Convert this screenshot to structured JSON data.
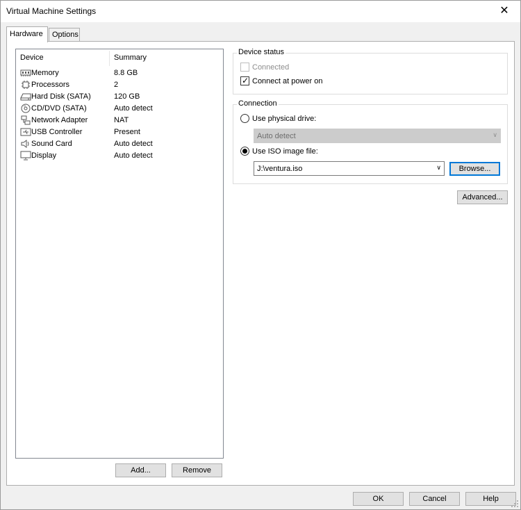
{
  "window": {
    "title": "Virtual Machine Settings",
    "close_glyph": "✕"
  },
  "tabs": [
    {
      "label": "Hardware",
      "active": true
    },
    {
      "label": "Options",
      "active": false
    }
  ],
  "device_list": {
    "columns": [
      "Device",
      "Summary"
    ],
    "rows": [
      {
        "icon": "memory-icon",
        "name": "Memory",
        "summary": "8.8 GB"
      },
      {
        "icon": "processor-icon",
        "name": "Processors",
        "summary": "2"
      },
      {
        "icon": "hard-disk-icon",
        "name": "Hard Disk (SATA)",
        "summary": "120 GB"
      },
      {
        "icon": "cd-dvd-icon",
        "name": "CD/DVD (SATA)",
        "summary": "Auto detect"
      },
      {
        "icon": "network-adapter-icon",
        "name": "Network Adapter",
        "summary": "NAT"
      },
      {
        "icon": "usb-icon",
        "name": "USB Controller",
        "summary": "Present"
      },
      {
        "icon": "sound-card-icon",
        "name": "Sound Card",
        "summary": "Auto detect"
      },
      {
        "icon": "display-icon",
        "name": "Display",
        "summary": "Auto detect"
      }
    ],
    "add_label": "Add...",
    "remove_label": "Remove"
  },
  "device_status": {
    "title": "Device status",
    "connected_label": "Connected",
    "connected_checked": false,
    "connected_enabled": false,
    "power_on_label": "Connect at power on",
    "power_on_checked": true
  },
  "connection": {
    "title": "Connection",
    "physical_label": "Use physical drive:",
    "physical_selected": false,
    "physical_value": "Auto detect",
    "iso_label": "Use ISO image file:",
    "iso_selected": true,
    "iso_value": "J:\\ventura.iso",
    "browse_label": "Browse..."
  },
  "advanced_label": "Advanced...",
  "footer": {
    "ok_label": "OK",
    "cancel_label": "Cancel",
    "help_label": "Help"
  }
}
